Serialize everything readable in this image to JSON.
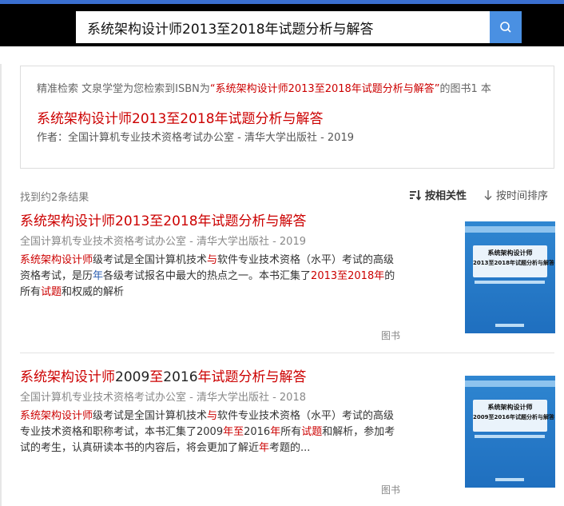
{
  "search": {
    "query": "系统架构设计师2013至2018年试题分析与解答"
  },
  "precise": {
    "intro": "精准检索 文泉学堂为您检索到ISBN为",
    "quote": "“系统架构设计师2013至2018年试题分析与解答”",
    "suffix": "的图书1 本",
    "title": "系统架构设计师2013至2018年试题分析与解答",
    "author": "作者：全国计算机专业技术资格考试办公室 - 清华大学出版社 - 2019"
  },
  "results_header": {
    "count": "找到约2条结果",
    "sort_relevance": "按相关性",
    "sort_time": "按时间排序"
  },
  "results": [
    {
      "title": "系统架构设计师2013至2018年试题分析与解答",
      "meta": "全国计算机专业技术资格考试办公室 - 清华大学出版社 - 2019",
      "desc_parts": [
        {
          "t": "系统架构设计师",
          "h": "hl"
        },
        {
          "t": "级考试是全国计算机技术",
          "h": ""
        },
        {
          "t": "与",
          "h": "hl"
        },
        {
          "t": "软件专业技术资格（水平）考试的高级资格考试，是历",
          "h": ""
        },
        {
          "t": "年",
          "h": "hb"
        },
        {
          "t": "各级考试报名中最大的热点之一。本书汇集了",
          "h": ""
        },
        {
          "t": "2013至2018年",
          "h": "hl"
        },
        {
          "t": "的所有",
          "h": ""
        },
        {
          "t": "试题",
          "h": "hl"
        },
        {
          "t": "和权威的解析",
          "h": ""
        }
      ],
      "type": "图书",
      "cover_title": "系统架构设计师",
      "cover_subtitle": "2013至2018年试题分析与解答"
    },
    {
      "title_parts": [
        {
          "t": "系统架构设计师",
          "h": "hl"
        },
        {
          "t": "2009",
          "h": "nm"
        },
        {
          "t": "至",
          "h": "hl"
        },
        {
          "t": "2016",
          "h": "nm"
        },
        {
          "t": "年试题分析与解答",
          "h": "hl"
        }
      ],
      "meta": "全国计算机专业技术资格考试办公室 - 清华大学出版社 - 2018",
      "desc_parts": [
        {
          "t": "系统架构设计师",
          "h": "hl"
        },
        {
          "t": "级考试是全国计算机技术",
          "h": ""
        },
        {
          "t": "与",
          "h": "hl"
        },
        {
          "t": "软件专业技术资格（水平）考试的高级专业技术资格和职称考试，本书汇集了2009",
          "h": ""
        },
        {
          "t": "年至",
          "h": "hl"
        },
        {
          "t": "2016",
          "h": ""
        },
        {
          "t": "年",
          "h": "hl"
        },
        {
          "t": "所有",
          "h": ""
        },
        {
          "t": "试题",
          "h": "hl"
        },
        {
          "t": "和解析，参加考试的考生，认真研读本书的内容后，将会更加了解近",
          "h": ""
        },
        {
          "t": "年",
          "h": "hl"
        },
        {
          "t": "考题的...",
          "h": ""
        }
      ],
      "type": "图书",
      "cover_title": "系统架构设计师",
      "cover_subtitle": "2009至2016年试题分析与解答"
    }
  ],
  "colors": {
    "highlight": "#cc0000",
    "accent": "#4a90e2"
  }
}
